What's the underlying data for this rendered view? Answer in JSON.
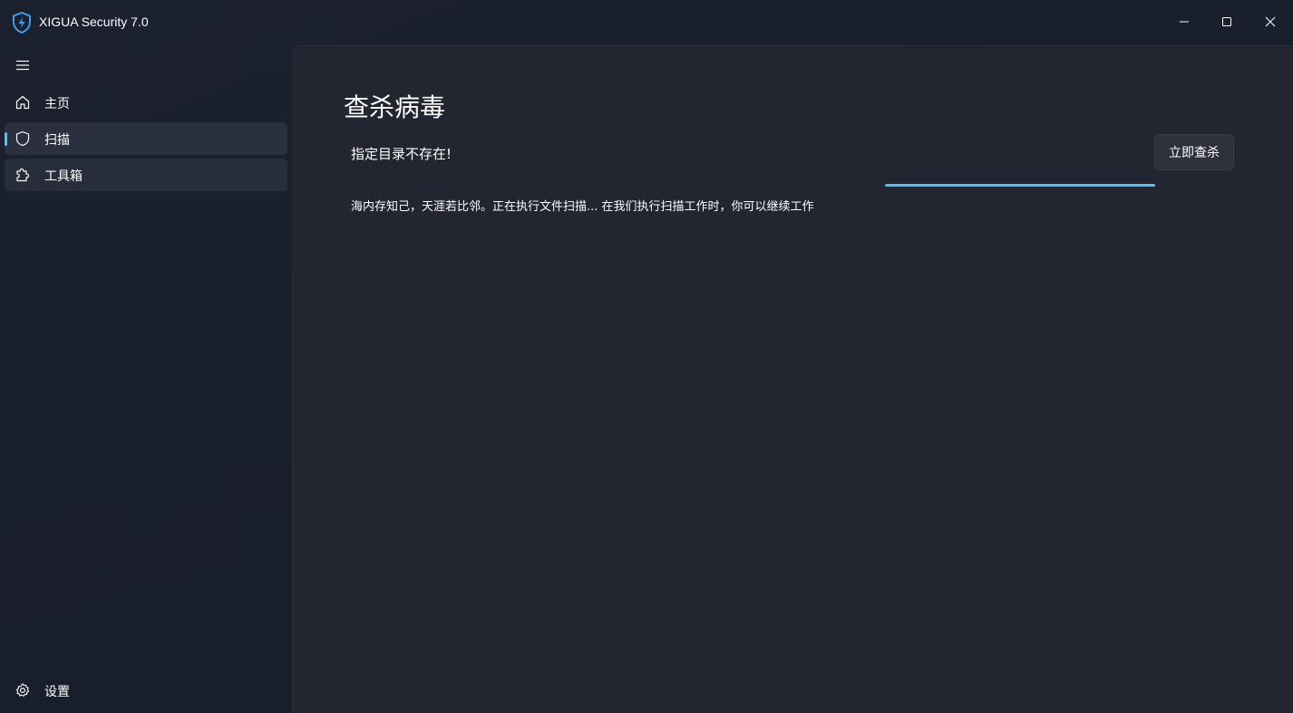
{
  "app": {
    "title": "XIGUA Security 7.0"
  },
  "window_controls": {
    "minimize": "minimize-icon",
    "maximize": "maximize-icon",
    "close": "close-icon"
  },
  "sidebar": {
    "menu_icon": "hamburger-icon",
    "items": [
      {
        "label": "主页",
        "icon": "home-icon",
        "selected": false
      },
      {
        "label": "扫描",
        "icon": "shield-icon",
        "selected": true
      },
      {
        "label": "工具箱",
        "icon": "puzzle-icon",
        "selected": false
      }
    ],
    "footer": {
      "label": "设置",
      "icon": "gear-icon"
    }
  },
  "main": {
    "title": "查杀病毒",
    "status": "指定目录不存在!",
    "scan_button_label": "立即查杀",
    "progress": 1.0,
    "message": "海内存知己，天涯若比邻。正在执行文件扫描...  在我们执行扫描工作时，你可以继续工作"
  },
  "colors": {
    "accent": "#4cc2ff",
    "content_bg": "#232631",
    "sidebar_bg": "#1a1f2d"
  }
}
